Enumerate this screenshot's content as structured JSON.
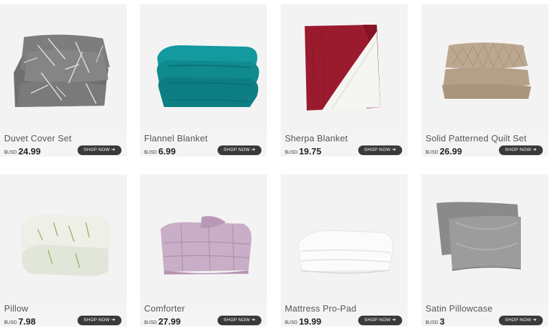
{
  "shop_label": "SHOP NOW",
  "shop_arrow": "➔",
  "products": [
    {
      "name": "Duvet Cover Set",
      "currency": "$USD",
      "price": "24.99",
      "icon": "duvet-cover-image"
    },
    {
      "name": "Flannel Blanket",
      "currency": "$USD",
      "price": "6.99",
      "icon": "flannel-blanket-image"
    },
    {
      "name": "Sherpa Blanket",
      "currency": "$USD",
      "price": "19.75",
      "icon": "sherpa-blanket-image"
    },
    {
      "name": "Solid Patterned Quilt Set",
      "currency": "$USD",
      "price": "26.99",
      "icon": "quilt-set-image"
    },
    {
      "name": "Pillow",
      "currency": "$USD",
      "price": "7.98",
      "icon": "pillow-image"
    },
    {
      "name": "Comforter",
      "currency": "$USD",
      "price": "27.99",
      "icon": "comforter-image"
    },
    {
      "name": "Mattress Pro-Pad",
      "currency": "$USD",
      "price": "19.99",
      "icon": "mattress-pad-image"
    },
    {
      "name": "Satin Pillowcase",
      "currency": "$USD",
      "price": "3",
      "icon": "satin-pillowcase-image"
    }
  ],
  "colors": {
    "card_bg": "#f3f3f3",
    "button_bg": "#3a3a3a",
    "duvet": "#7a7a7a",
    "flannel": "#0f8a8f",
    "sherpa": "#9b1b2e",
    "quilt": "#b8a68e",
    "pillow": "#ecefe6",
    "comforter": "#c6a9c4",
    "mattress": "#f7f7f7",
    "satin": "#8f8f8f"
  }
}
